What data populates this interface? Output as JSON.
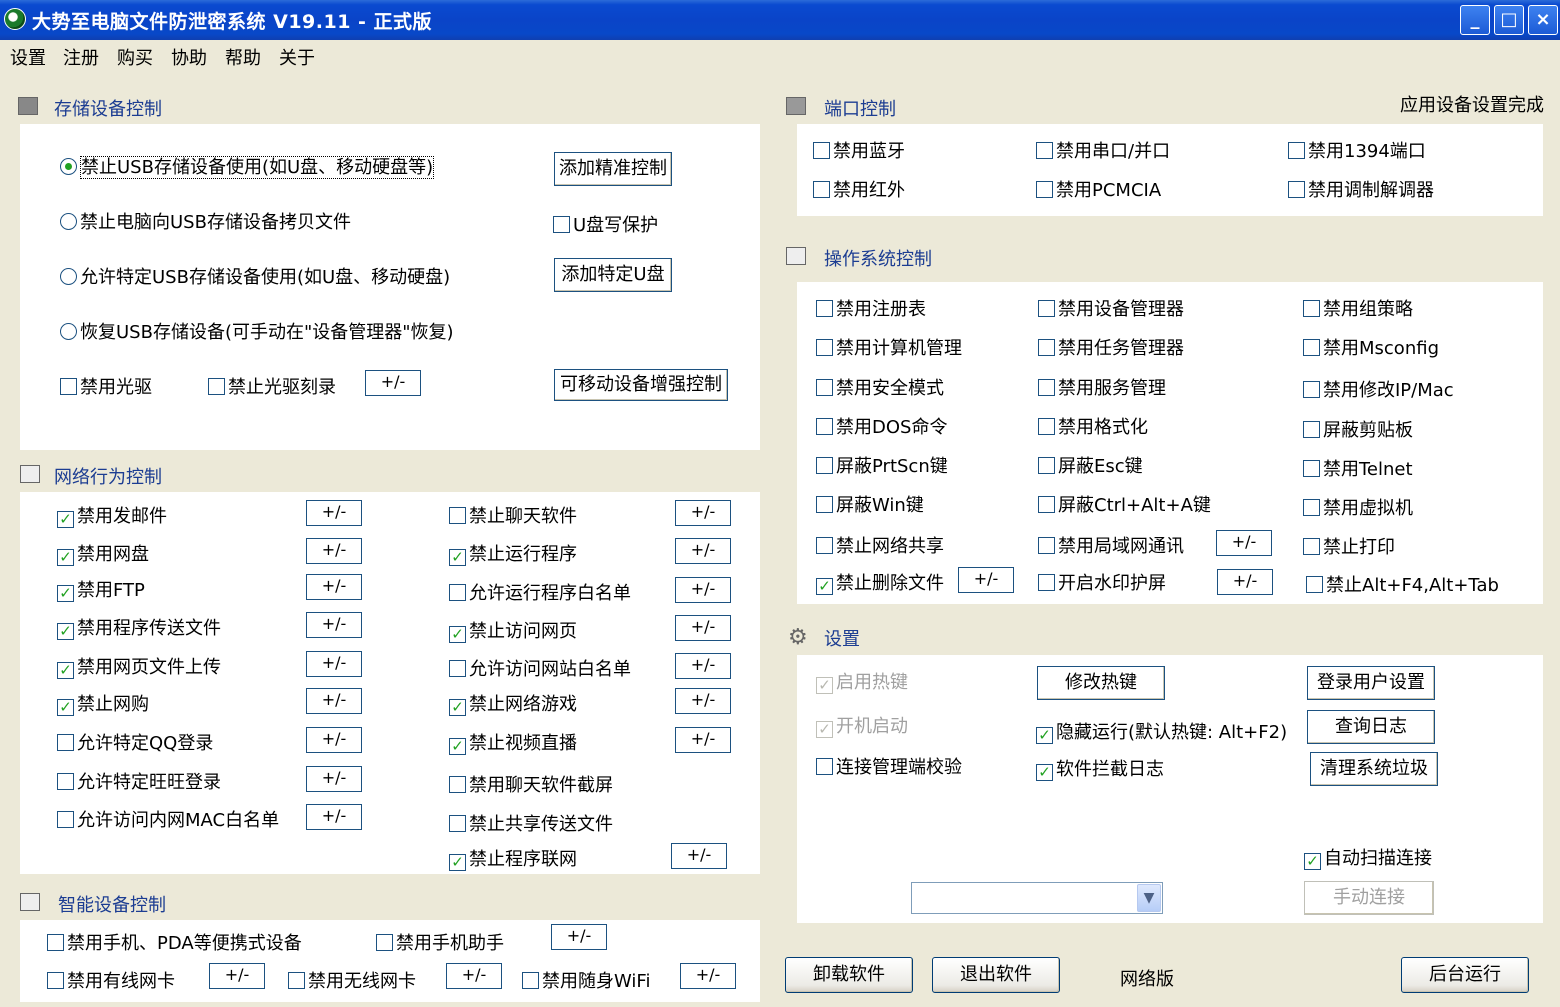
{
  "window": {
    "title": "大势至电脑文件防泄密系统 V19.11 - 正式版"
  },
  "menu": [
    "设置",
    "注册",
    "购买",
    "协助",
    "帮助",
    "关于"
  ],
  "status_text": "应用设备设置完成",
  "storage": {
    "title": "存储设备控制",
    "radios": [
      "禁止USB存储设备使用(如U盘、移动硬盘等)",
      "禁止电脑向USB存储设备拷贝文件",
      "允许特定USB存储设备使用(如U盘、移动硬盘)",
      "恢复USB存储设备(可手动在\"设备管理器\"恢复)"
    ],
    "btn_precise": "添加精准控制",
    "cb_u_write": "U盘写保护",
    "btn_add_u": "添加特定U盘",
    "cb_cdrom": "禁用光驱",
    "cb_cd_burn": "禁止光驱刻录",
    "pm": "+/-",
    "btn_removable": "可移动设备增强控制"
  },
  "network": {
    "title": "网络行为控制",
    "left": [
      "禁用发邮件",
      "禁用网盘",
      "禁用FTP",
      "禁用程序传送文件",
      "禁用网页文件上传",
      "禁止网购",
      "允许特定QQ登录",
      "允许特定旺旺登录",
      "允许访问内网MAC白名单"
    ],
    "right": [
      "禁止聊天软件",
      "禁止运行程序",
      "允许运行程序白名单",
      "禁止访问网页",
      "允许访问网站白名单",
      "禁止网络游戏",
      "禁止视频直播",
      "禁用聊天软件截屏",
      "禁止共享传送文件",
      "禁止程序联网"
    ]
  },
  "smart": {
    "title": "智能设备控制",
    "items": [
      "禁用手机、PDA等便携式设备",
      "禁用手机助手",
      "禁用有线网卡",
      "禁用无线网卡",
      "禁用随身WiFi"
    ]
  },
  "port": {
    "title": "端口控制",
    "items": [
      "禁用蓝牙",
      "禁用串口/并口",
      "禁用1394端口",
      "禁用红外",
      "禁用PCMCIA",
      "禁用调制解调器"
    ]
  },
  "os": {
    "title": "操作系统控制",
    "col1": [
      "禁用注册表",
      "禁用计算机管理",
      "禁用安全模式",
      "禁用DOS命令",
      "屏蔽PrtScn键",
      "屏蔽Win键",
      "禁止网络共享",
      "禁止删除文件"
    ],
    "col2": [
      "禁用设备管理器",
      "禁用任务管理器",
      "禁用服务管理",
      "禁用格式化",
      "屏蔽Esc键",
      "屏蔽Ctrl+Alt+A键",
      "禁用局域网通讯",
      "开启水印护屏"
    ],
    "col3": [
      "禁用组策略",
      "禁用Msconfig",
      "禁用修改IP/Mac",
      "屏蔽剪贴板",
      "禁用Telnet",
      "禁用虚拟机",
      "禁止打印",
      "禁止Alt+F4,Alt+Tab"
    ]
  },
  "settings": {
    "title": "设置",
    "cb_hotkey": "启用热键",
    "cb_autostart": "开机启动",
    "cb_verify": "连接管理端校验",
    "btn_modify_hotkey": "修改热键",
    "cb_hidden": "隐藏运行(默认热键: Alt+F2)",
    "cb_log": "软件拦截日志",
    "btn_login_user": "登录用户设置",
    "btn_query_log": "查询日志",
    "btn_clean": "清理系统垃圾",
    "cb_auto_scan": "自动扫描连接",
    "btn_manual_connect": "手动连接",
    "combo_value": ""
  },
  "footer": {
    "btn_uninstall": "卸载软件",
    "btn_exit": "退出软件",
    "version": "网络版",
    "btn_background": "后台运行"
  }
}
